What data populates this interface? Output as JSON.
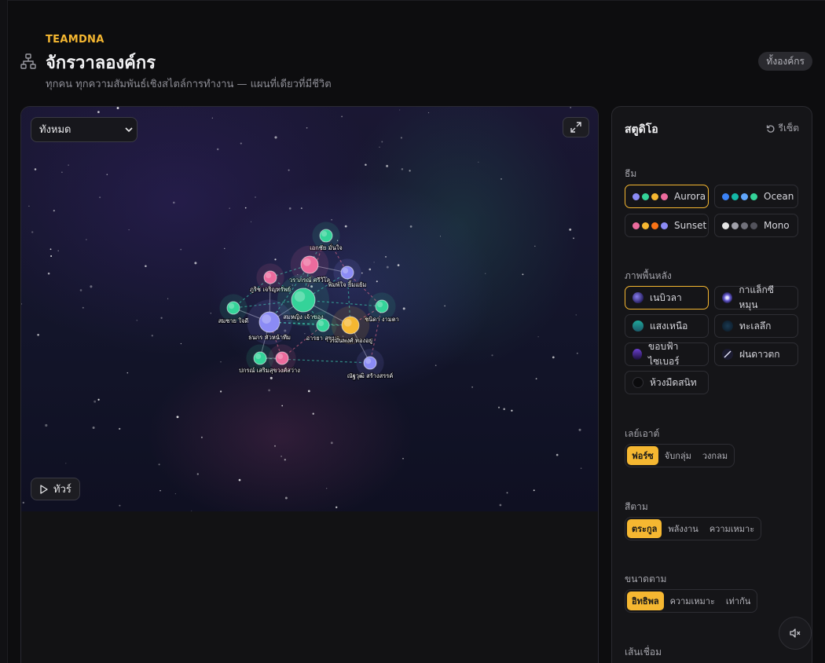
{
  "header": {
    "brand": "TEAMDNA",
    "title": "จักรวาลองค์กร",
    "subtitle": "ทุกคน ทุกความสัมพันธ์เชิงสไตล์การทำงาน — แผนที่เดียวที่มีชีวิต",
    "scope_badge": "ทั้งองค์กร",
    "icon": "org-chart-icon"
  },
  "canvas": {
    "filter": {
      "selected": "ทั้งหมด",
      "options": [
        "ทั้งหมด"
      ]
    },
    "tour_label": "ทัวร์",
    "expand_icon": "expand-icon",
    "nodes": [
      {
        "label": "เอกชัย มั่นใจ",
        "color": "#34d399"
      },
      {
        "label": "วราภรณ์ ศรีวิไล",
        "color": "#ec6b9d"
      },
      {
        "label": "ภูริช เจริญทรัพย์",
        "color": "#ec6b9d"
      },
      {
        "label": "พิมพ์ใจ ยิ้มแย้ม",
        "color": "#8b8bf5"
      },
      {
        "label": "สมหญิง เจ้าของ",
        "color": "#34d399"
      },
      {
        "label": "ชนิดา งามตา",
        "color": "#34d399"
      },
      {
        "label": "สมชาย ใจดี",
        "color": "#34d399"
      },
      {
        "label": "ธนกร หัวหน้าทีม",
        "color": "#8b8bf5"
      },
      {
        "label": "อารยา สุขุมล",
        "color": "#34d399"
      },
      {
        "label": "วรมันพงศ์ ทองอยู่",
        "color": "#f5b731"
      },
      {
        "label": "ปกรณ์ เสริมสุขวงศ์สว่าง",
        "color": "#34d399"
      },
      {
        "label": "ณัฐวุฒิ สร้างสรรค์",
        "color": "#8b8bf5"
      }
    ]
  },
  "studio": {
    "title": "สตูดิโอ",
    "reset_label": "รีเซ็ต",
    "theme": {
      "label": "ธีม",
      "options": [
        {
          "name": "Aurora",
          "colors": [
            "#8b8bf5",
            "#34d399",
            "#f5b731",
            "#ec6b9d"
          ],
          "active": true
        },
        {
          "name": "Ocean",
          "colors": [
            "#3b82f6",
            "#14b8a6",
            "#60a5fa",
            "#34d399"
          ],
          "active": false
        },
        {
          "name": "Sunset",
          "colors": [
            "#ec6b9d",
            "#f5b731",
            "#f97316",
            "#8b8bf5"
          ],
          "active": false
        },
        {
          "name": "Mono",
          "colors": [
            "#e5e5e5",
            "#a1a1aa",
            "#71717a",
            "#52525b"
          ],
          "active": false
        }
      ]
    },
    "background": {
      "label": "ภาพพื้นหลัง",
      "options": [
        {
          "name": "เนบิวลา",
          "active": true
        },
        {
          "name": "กาแล็กซีหมุน",
          "active": false
        },
        {
          "name": "แสงเหนือ",
          "active": false
        },
        {
          "name": "ทะเลลึก",
          "active": false
        },
        {
          "name": "ขอบฟ้าไซเบอร์",
          "active": false
        },
        {
          "name": "ฝนดาวตก",
          "active": false
        },
        {
          "name": "ห้วงมืดสนิท",
          "active": false
        }
      ]
    },
    "layout": {
      "label": "เลย์เอาต์",
      "options": [
        "ฟอร์ซ",
        "จับกลุ่ม",
        "วงกลม"
      ],
      "active": 0
    },
    "color_by": {
      "label": "สีตาม",
      "options": [
        "ตระกูล",
        "พลังงาน",
        "ความเหมาะ"
      ],
      "active": 0
    },
    "size_by": {
      "label": "ขนาดตาม",
      "options": [
        "อิทธิพล",
        "ความเหมาะ",
        "เท่ากัน"
      ],
      "active": 0
    },
    "links": {
      "label": "เส้นเชื่อม"
    }
  },
  "mute_icon": "speaker-muted-icon"
}
